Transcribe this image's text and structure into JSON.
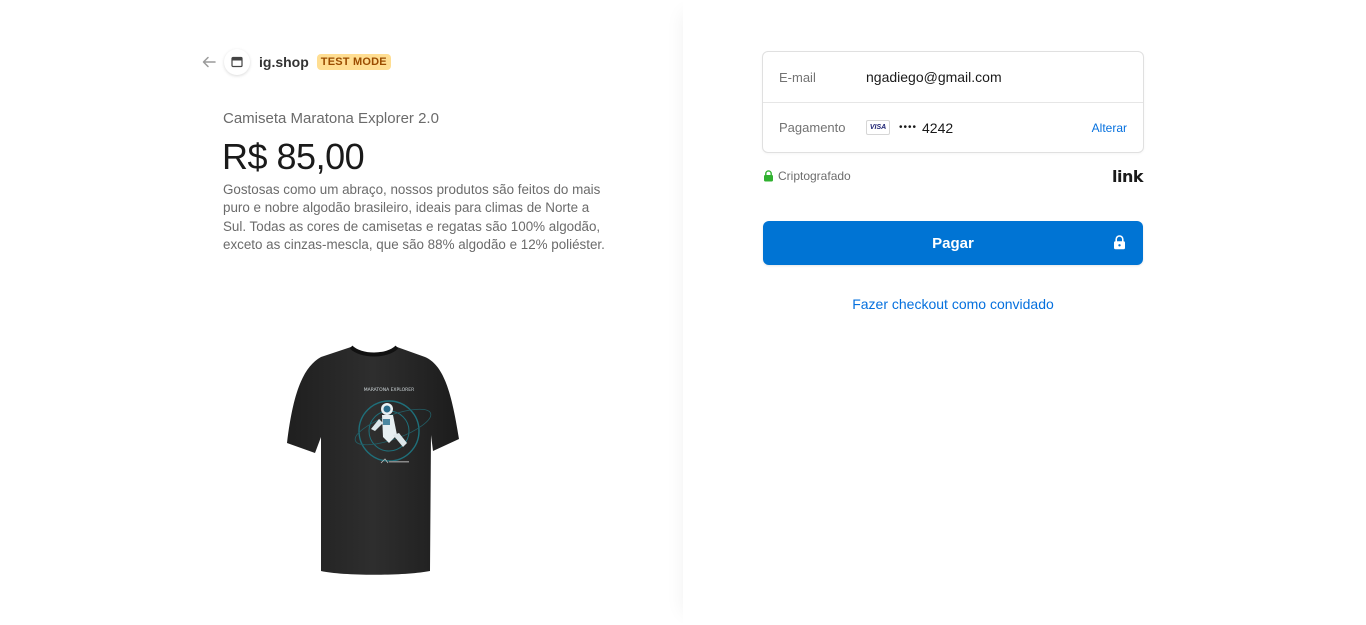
{
  "header": {
    "store_name": "ig.shop",
    "test_badge": "TEST MODE"
  },
  "product": {
    "name": "Camiseta Maratona Explorer 2.0",
    "price": "R$ 85,00",
    "description": "Gostosas como um abraço, nossos produtos são feitos do mais puro e nobre algodão brasileiro, ideais para climas de Norte a Sul. Todas as cores de camisetas e regatas são 100% algodão, exceto as cinzas-mescla, que são 88% algodão e 12% poliéster.",
    "shirt_print": "MARATONA EXPLORER"
  },
  "form": {
    "email_label": "E-mail",
    "email_value": "ngadiego@gmail.com",
    "payment_label": "Pagamento",
    "card_brand": "VISA",
    "card_dots": "••••",
    "card_last4": "4242",
    "change_label": "Alterar"
  },
  "security": {
    "encrypted_label": "Criptografado",
    "link_logo": "link"
  },
  "actions": {
    "pay_label": "Pagar",
    "guest_checkout_label": "Fazer checkout como convidado"
  },
  "colors": {
    "accent": "#0074d4",
    "link": "#0570de",
    "badge_bg": "#ffde92",
    "badge_text": "#9b4c00",
    "secure_green": "#30b130"
  }
}
